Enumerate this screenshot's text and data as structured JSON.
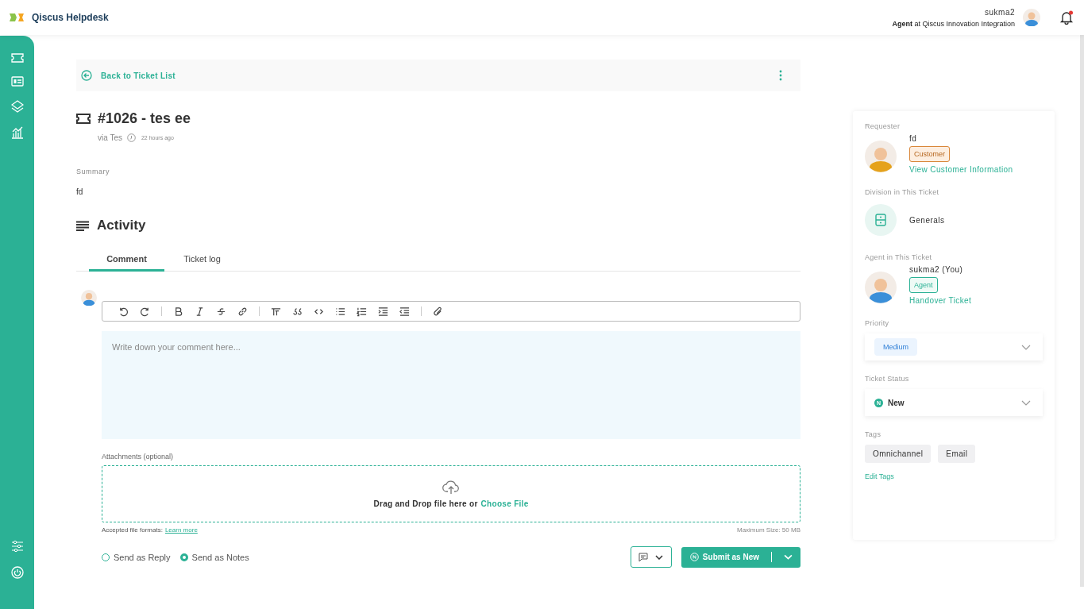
{
  "app": {
    "title": "Qiscus Helpdesk"
  },
  "user": {
    "name": "sukma2",
    "role_line": "**Agent** at Qiscus Innovation Integration"
  },
  "notifications": {
    "unread": true
  },
  "back_link": "Back to Ticket List",
  "ticket": {
    "title": "#1026 - tes ee",
    "channel": "via Tes",
    "time": "22 hours ago"
  },
  "summary": {
    "label": "Summary",
    "text": "fd"
  },
  "activity": {
    "heading": "Activity",
    "tabs": [
      {
        "label": "Comment",
        "selected": true
      },
      {
        "label": "Ticket log",
        "selected": false
      }
    ]
  },
  "editor": {
    "placeholder": "Write down your comment here..."
  },
  "attachments": {
    "label": "Attachments (optional)",
    "drop_text": "Drag and Drop file here or",
    "choose": "Choose File",
    "formats": "Accepted file formats:",
    "learn_more": "Learn more",
    "max_size": "Maximum Size: 50 MB"
  },
  "send_options": [
    {
      "label": "Send as Reply",
      "selected": false
    },
    {
      "label": "Send as Notes",
      "selected": true
    }
  ],
  "submit": "Submit as New",
  "details": {
    "requester": {
      "label": "Requester",
      "name": "fd",
      "badge": "Customer",
      "link": "View Customer Information"
    },
    "division": {
      "label": "Division in This Ticket",
      "name": "Generals"
    },
    "agent": {
      "label": "Agent in This Ticket",
      "name": "sukma2 (You)",
      "badge": "Agent",
      "link": "Handover Ticket"
    },
    "priority": {
      "label": "Priority",
      "value": "Medium"
    },
    "status": {
      "label": "Ticket Status",
      "initial": "N",
      "value": "New"
    },
    "tags": {
      "label": "Tags",
      "items": [
        "Omnichannel",
        "Email"
      ],
      "edit": "Edit Tags"
    }
  }
}
